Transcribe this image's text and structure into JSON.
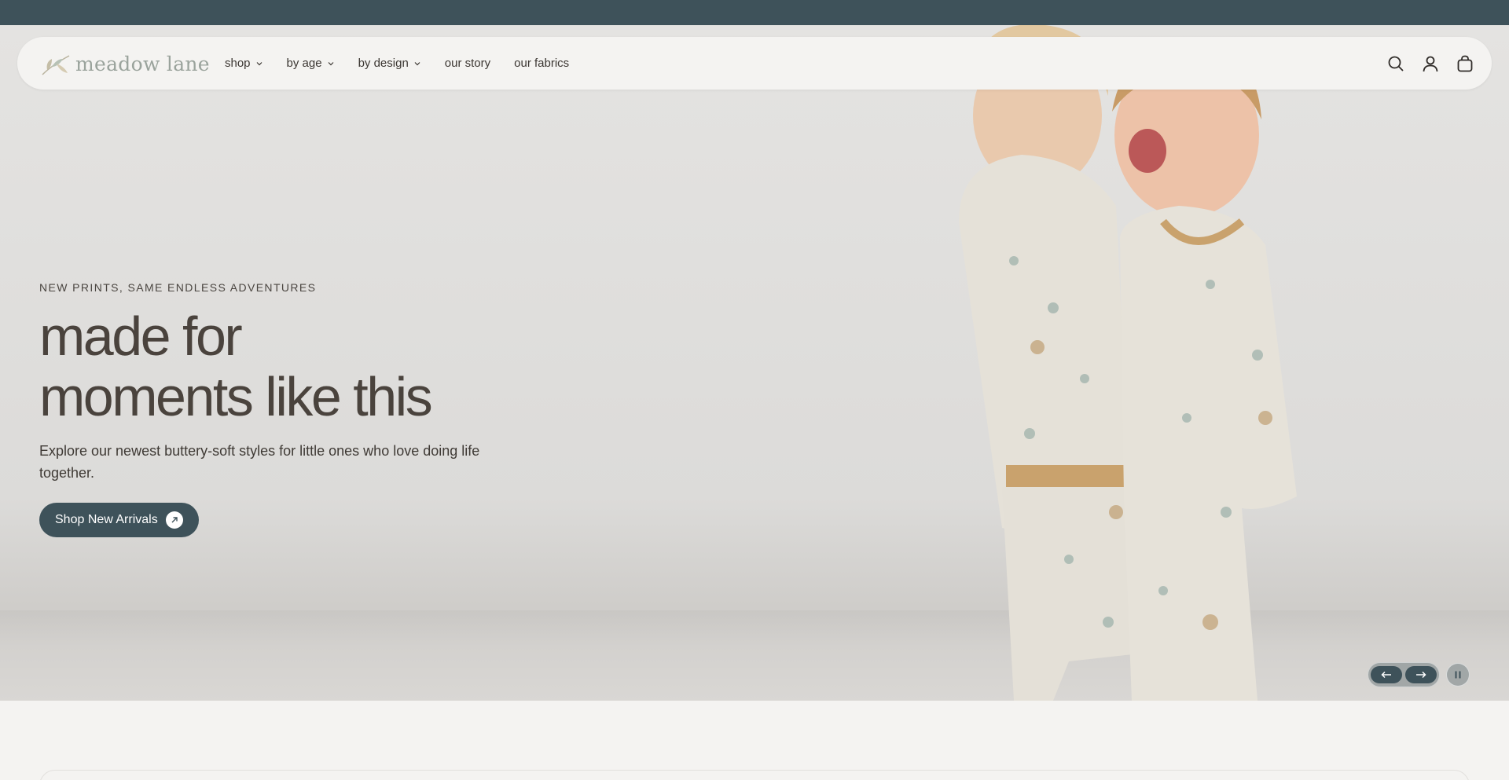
{
  "header": {
    "logo_text": "meadow lane",
    "nav": [
      {
        "label": "shop",
        "has_dropdown": true
      },
      {
        "label": "by age",
        "has_dropdown": true
      },
      {
        "label": "by design",
        "has_dropdown": true
      },
      {
        "label": "our story",
        "has_dropdown": false
      },
      {
        "label": "our fabrics",
        "has_dropdown": false
      }
    ],
    "icons": [
      "search-icon",
      "account-icon",
      "bag-icon"
    ]
  },
  "hero": {
    "eyebrow": "NEW PRINTS, SAME ENDLESS ADVENTURES",
    "headline_line1": "made for",
    "headline_line2": "moments like this",
    "subtext": "Explore our newest buttery-soft styles for little ones who love doing life together.",
    "cta_label": "Shop New Arrivals"
  },
  "slider": {
    "prev_icon": "arrow-left-icon",
    "next_icon": "arrow-right-icon",
    "pause_icon": "pause-icon"
  },
  "colors": {
    "brand": "#3e525a",
    "text": "#4a433d",
    "background": "#f4f3f1",
    "logo": "#9aa39c"
  }
}
